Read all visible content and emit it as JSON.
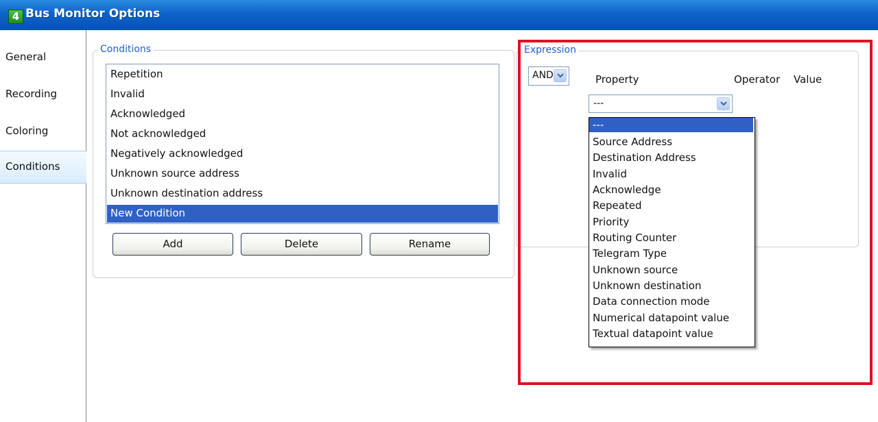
{
  "window": {
    "title": "Bus Monitor Options",
    "logo_text": "4"
  },
  "sidebar": {
    "items": [
      {
        "label": "General"
      },
      {
        "label": "Recording"
      },
      {
        "label": "Coloring"
      },
      {
        "label": "Conditions",
        "selected": true
      }
    ]
  },
  "conditions": {
    "legend": "Conditions",
    "items": [
      "Repetition",
      "Invalid",
      "Acknowledged",
      "Not acknowledged",
      "Negatively acknowledged",
      "Unknown source address",
      "Unknown destination address",
      "New Condition"
    ],
    "selected_index": 7,
    "buttons": {
      "add": "Add",
      "delete": "Delete",
      "rename": "Rename"
    }
  },
  "expression": {
    "legend": "Expression",
    "logic_select": {
      "value": "AND"
    },
    "columns": {
      "property": "Property",
      "operator": "Operator",
      "value": "Value"
    },
    "property_select": {
      "value": "---",
      "options": [
        "---",
        "Source Address",
        "Destination Address",
        "Invalid",
        "Acknowledge",
        "Repeated",
        "Priority",
        "Routing Counter",
        "Telegram Type",
        "Unknown source",
        "Unknown destination",
        "Data connection mode",
        "Numerical datapoint value",
        "Textual datapoint value"
      ],
      "highlighted_index": 0
    }
  },
  "colors": {
    "titlebar": "#0d63c9",
    "selection": "#2f61c5",
    "legend_text": "#1e5fc9",
    "annotation_border": "#e01020"
  }
}
